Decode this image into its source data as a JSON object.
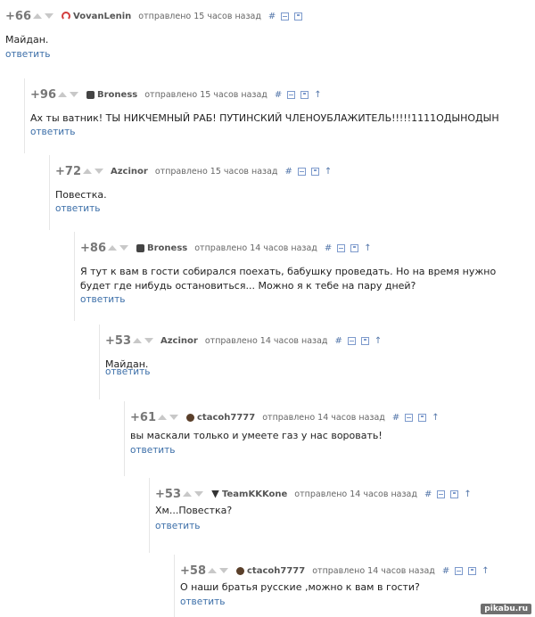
{
  "comments": [
    {
      "score": "+66",
      "author": "VovanLenin",
      "time": "отправлено 15 часов назад",
      "text": "Майдан.",
      "reply": "ответить",
      "avatar": "red-circle-icon",
      "show_parent": false
    },
    {
      "score": "+96",
      "author": "Broness",
      "time": "отправлено 15 часов назад",
      "text": "Ах ты ватник! ТЫ НИКЧЕМНЫЙ РАБ! ПУТИНСКИЙ ЧЛЕНОУБЛАЖИТЕЛЬ!!!!!1111ОДЫНОДЫН",
      "reply": "ответить",
      "avatar": "dark-square-icon",
      "show_parent": true
    },
    {
      "score": "+72",
      "author": "Azcinor",
      "time": "отправлено 15 часов назад",
      "text": "Повестка.",
      "reply": "ответить",
      "avatar": "none",
      "show_parent": true
    },
    {
      "score": "+86",
      "author": "Broness",
      "time": "отправлено 14 часов назад",
      "text": "Я тут к вам в гости собирался поехать, бабушку проведать. Но на время нужно будет где нибудь остановиться... Можно я к тебе на пару дней?",
      "reply": "ответить",
      "avatar": "dark-square-icon",
      "show_parent": true
    },
    {
      "score": "+53",
      "author": "Azcinor",
      "time": "отправлено 14 часов назад",
      "text": "Майдан.",
      "reply": "ответить",
      "avatar": "none",
      "show_parent": true
    },
    {
      "score": "+61",
      "author": "ctacoh7777",
      "time": "отправлено 14 часов назад",
      "text": "вы маскали только и умеете газ у нас воровать!",
      "reply": "ответить",
      "avatar": "brown-circle-icon",
      "show_parent": true
    },
    {
      "score": "+53",
      "author": "TeamKKKone",
      "time": "отправлено 14 часов назад",
      "text": "Хм...Повестка?",
      "reply": "ответить",
      "avatar": "badge-icon",
      "show_parent": true
    },
    {
      "score": "+58",
      "author": "ctacoh7777",
      "time": "отправлено 14 часов назад",
      "text": "О наши братья русские ,можно к вам в гости?",
      "reply": "ответить",
      "avatar": "brown-circle-icon",
      "show_parent": true
    }
  ],
  "icons": {
    "link": "#",
    "parent": "↑"
  },
  "watermark": "pikabu.ru"
}
